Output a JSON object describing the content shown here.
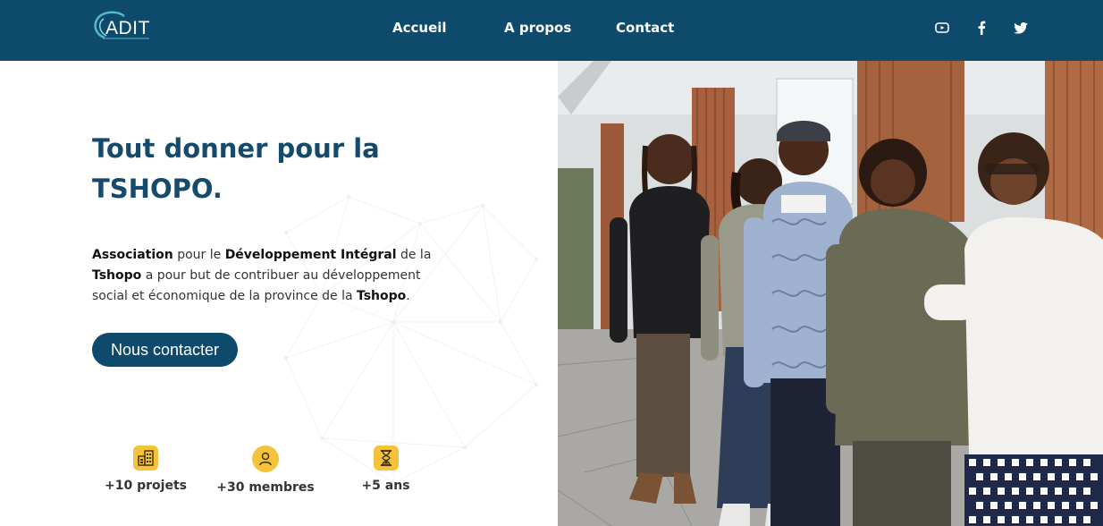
{
  "header": {
    "logo_text": "ADIT",
    "nav": [
      "Accueil",
      "A propos",
      "Contact"
    ],
    "social": [
      "youtube-icon",
      "facebook-icon",
      "twitter-icon"
    ]
  },
  "hero": {
    "title": "Tout donner pour la TSHOPO.",
    "desc": {
      "b1": "Association",
      "t1": " pour le ",
      "b2": "Développement Intégral",
      "t2": " de la ",
      "b3": "Tshopo",
      "t3": " a pour but de contribuer au développement social et économique de la province de la ",
      "b4": "Tshopo",
      "t4": "."
    },
    "cta": "Nous contacter"
  },
  "stats": [
    {
      "icon": "building-icon",
      "label": "+10 projets"
    },
    {
      "icon": "person-icon",
      "label": "+30 membres"
    },
    {
      "icon": "hourglass-icon",
      "label": "+5 ans"
    }
  ],
  "colors": {
    "primary": "#0e4a6b",
    "accent": "#f5c33b",
    "title": "#154a6a"
  }
}
